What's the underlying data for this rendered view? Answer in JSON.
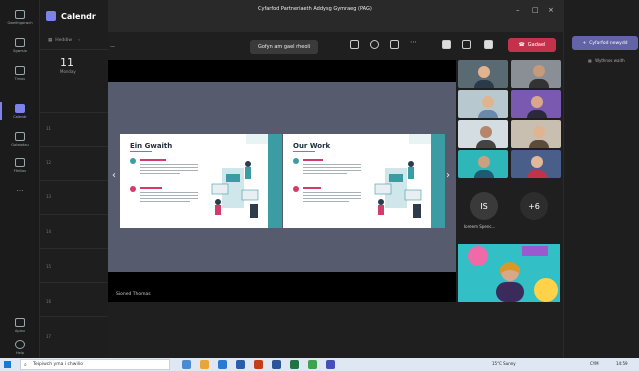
{
  "window": {
    "title": "Cyfarfod Partneriaeth Addysg Gymraeg (PAG)",
    "minimize": "–",
    "maximize": "□",
    "close": "×"
  },
  "rail": {
    "items": [
      {
        "label": "Gweithgarwch"
      },
      {
        "label": "Sgwrsio"
      },
      {
        "label": "Timau"
      },
      {
        "label": "Calendr"
      },
      {
        "label": "Galwadau"
      },
      {
        "label": "Ffeiliau"
      },
      {
        "label": "…"
      },
      {
        "label": "Apiau"
      },
      {
        "label": "Help"
      }
    ]
  },
  "calendar": {
    "title": "Calendr",
    "today_label": "Heddiw",
    "day_number": "11",
    "day_name": "Monday",
    "hours": [
      "11",
      "12",
      "13",
      "14",
      "15",
      "16",
      "17"
    ]
  },
  "toolbar": {
    "topic_label": "—",
    "request_control": "Gofyn am gael rheoli",
    "leave": "Gadael"
  },
  "slides": [
    {
      "title": "Ein Gwaith"
    },
    {
      "title": "Our Work"
    }
  ],
  "presenter_name": "Sioned Thomas",
  "participants": {
    "initials": "IS",
    "initials_name": "Ioreem Spenc...",
    "more_count": "+6"
  },
  "right_panel": {
    "new_meeting": "Cyfarfod newydd",
    "view_label": "Wythnos waith"
  },
  "taskbar": {
    "search_placeholder": "Teipiwch yma i chwilio",
    "weather": "15°C Sunny",
    "language": "CYM",
    "time": "14:59"
  },
  "colors": {
    "accent": "#6264a7",
    "leave": "#c4314b",
    "slide_teal": "#3b9da3",
    "slide_pink": "#d63a6b"
  }
}
